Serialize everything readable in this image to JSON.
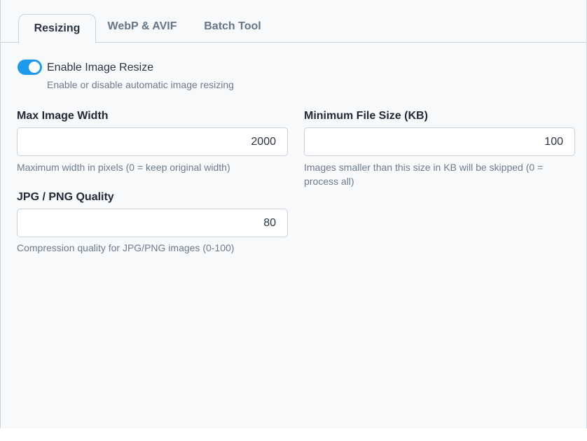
{
  "tabs": [
    {
      "label": "Resizing",
      "active": true
    },
    {
      "label": "WebP & AVIF",
      "active": false
    },
    {
      "label": "Batch Tool",
      "active": false
    }
  ],
  "resize_toggle": {
    "label": "Enable Image Resize",
    "description": "Enable or disable automatic image resizing",
    "enabled": true,
    "color": "#1e9be8"
  },
  "fields": {
    "max_width": {
      "label": "Max Image Width",
      "value": "2000",
      "help": "Maximum width in pixels (0 = keep original width)"
    },
    "min_size": {
      "label": "Minimum File Size (KB)",
      "value": "100",
      "help": "Images smaller than this size in KB will be skipped (0 = process all)"
    },
    "quality": {
      "label": "JPG / PNG Quality",
      "value": "80",
      "help": "Compression quality for JPG/PNG images (0-100)"
    }
  }
}
